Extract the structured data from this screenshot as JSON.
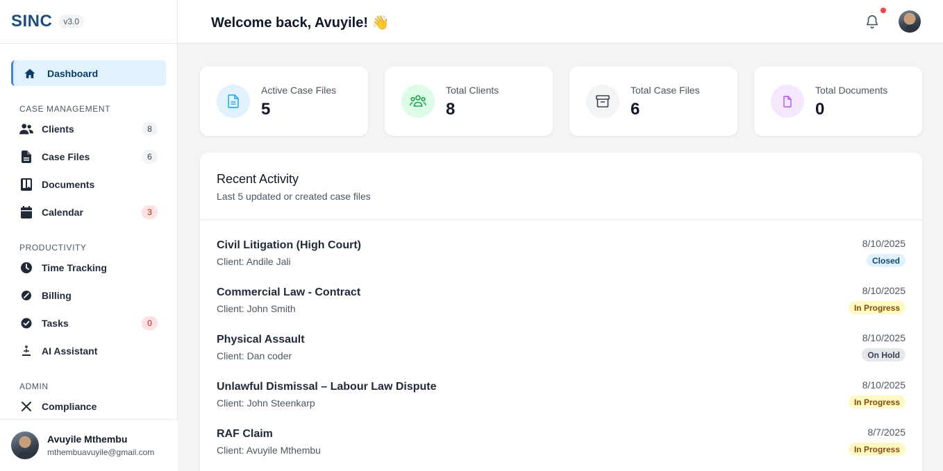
{
  "brand": {
    "name": "SINC",
    "version": "v3.0"
  },
  "nav": {
    "dashboard": "Dashboard",
    "sections": {
      "case_management": "CASE MANAGEMENT",
      "productivity": "PRODUCTIVITY",
      "admin": "ADMIN"
    },
    "items": [
      {
        "label": "Clients",
        "badge": "8"
      },
      {
        "label": "Case Files",
        "badge": "6"
      },
      {
        "label": "Documents"
      },
      {
        "label": "Calendar",
        "badge": "3"
      },
      {
        "label": "Time Tracking"
      },
      {
        "label": "Billing"
      },
      {
        "label": "Tasks",
        "badge": "0"
      },
      {
        "label": "AI Assistant"
      },
      {
        "label": "Compliance"
      }
    ]
  },
  "user": {
    "name": "Avuyile Mthembu",
    "email": "mthembuavuyile@gmail.com"
  },
  "header": {
    "welcome": "Welcome back, Avuyile! 👋"
  },
  "stats": [
    {
      "label": "Active Case Files",
      "value": "5",
      "icon": "document-icon",
      "color": "#0ea5e9"
    },
    {
      "label": "Total Clients",
      "value": "8",
      "icon": "users-icon",
      "color": "#16a34a"
    },
    {
      "label": "Total Case Files",
      "value": "6",
      "icon": "archive-icon",
      "color": "#374151"
    },
    {
      "label": "Total Documents",
      "value": "0",
      "icon": "file-icon",
      "color": "#a855f7"
    }
  ],
  "activity": {
    "title": "Recent Activity",
    "subtitle": "Last 5 updated or created case files",
    "rows": [
      {
        "case": "Civil Litigation (High Court)",
        "client": "Client: Andile Jali",
        "date": "8/10/2025",
        "status": "Closed"
      },
      {
        "case": "Commercial Law - Contract",
        "client": "Client: John Smith",
        "date": "8/10/2025",
        "status": "In Progress"
      },
      {
        "case": "Physical Assault",
        "client": "Client: Dan coder",
        "date": "8/10/2025",
        "status": "On Hold"
      },
      {
        "case": "Unlawful Dismissal – Labour Law Dispute",
        "client": "Client: John Steenkarp",
        "date": "8/10/2025",
        "status": "In Progress"
      },
      {
        "case": "RAF Claim",
        "client": "Client: Avuyile Mthembu",
        "date": "8/7/2025",
        "status": "In Progress"
      }
    ]
  },
  "colors": {
    "brand": "#1e4d7b",
    "active_bg": "#e0f2fe",
    "accent": "#3b82f6",
    "alert": "#ef4444"
  }
}
